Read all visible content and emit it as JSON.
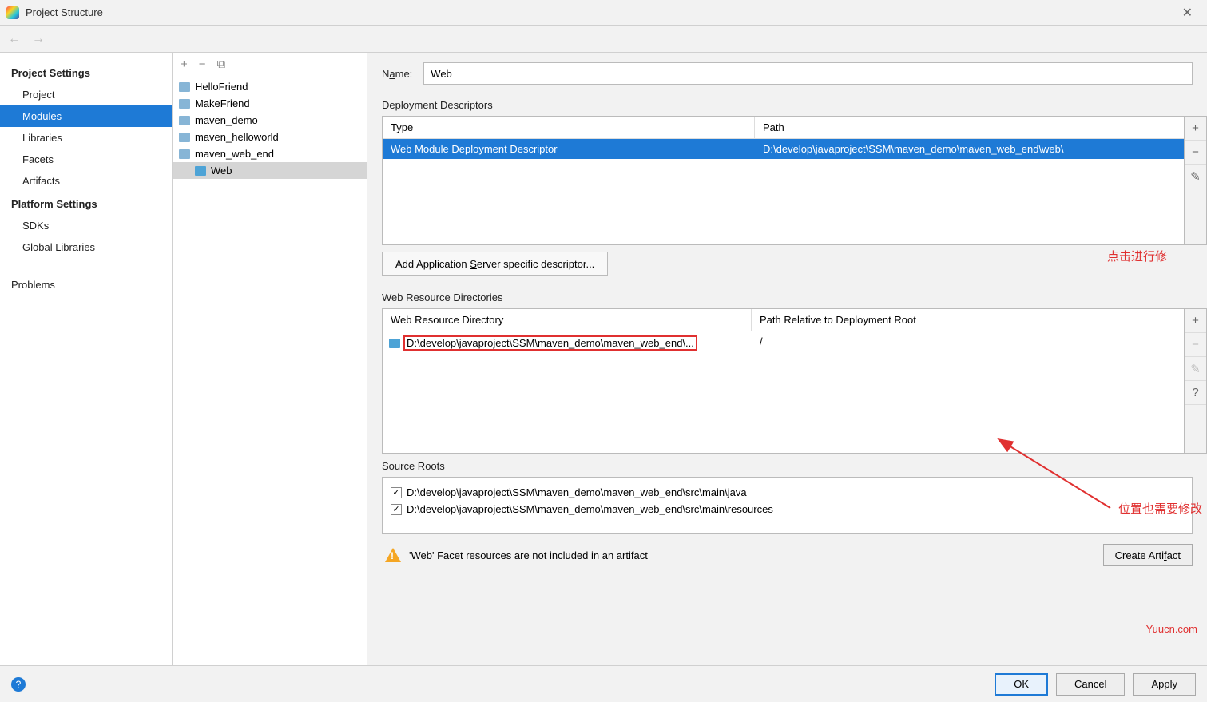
{
  "titlebar": {
    "title": "Project Structure"
  },
  "sidebar": {
    "section1": "Project Settings",
    "items1": [
      "Project",
      "Modules",
      "Libraries",
      "Facets",
      "Artifacts"
    ],
    "section2": "Platform Settings",
    "items2": [
      "SDKs",
      "Global Libraries"
    ],
    "section3": "Problems"
  },
  "tree": {
    "items": [
      {
        "label": "HelloFriend"
      },
      {
        "label": "MakeFriend"
      },
      {
        "label": "maven_demo"
      },
      {
        "label": "maven_helloworld"
      },
      {
        "label": "maven_web_end"
      },
      {
        "label": "Web",
        "indent": true,
        "selected": true
      }
    ]
  },
  "content": {
    "name_label": "Name:",
    "name_value": "Web",
    "deploy_label": "Deployment Descriptors",
    "deploy_head_type": "Type",
    "deploy_head_path": "Path",
    "deploy_row_type": "Web Module Deployment Descriptor",
    "deploy_row_path": "D:\\develop\\javaproject\\SSM\\maven_demo\\maven_web_end\\web\\",
    "add_server_btn": "Add Application Server specific descriptor...",
    "webres_label": "Web Resource Directories",
    "webres_head_dir": "Web Resource Directory",
    "webres_head_rel": "Path Relative to Deployment Root",
    "webres_row_dir": "D:\\develop\\javaproject\\SSM\\maven_demo\\maven_web_end\\...",
    "webres_row_rel": "/",
    "src_label": "Source Roots",
    "src1": "D:\\develop\\javaproject\\SSM\\maven_demo\\maven_web_end\\src\\main\\java",
    "src2": "D:\\develop\\javaproject\\SSM\\maven_demo\\maven_web_end\\src\\main\\resources",
    "warning": "'Web' Facet resources are not included in an artifact",
    "create_artifact": "Create Artifact"
  },
  "annotations": {
    "a1": "点击进行修",
    "a2": "位置也需要修改",
    "watermark": "Yuucn.com"
  },
  "footer": {
    "ok": "OK",
    "cancel": "Cancel",
    "apply": "Apply"
  }
}
